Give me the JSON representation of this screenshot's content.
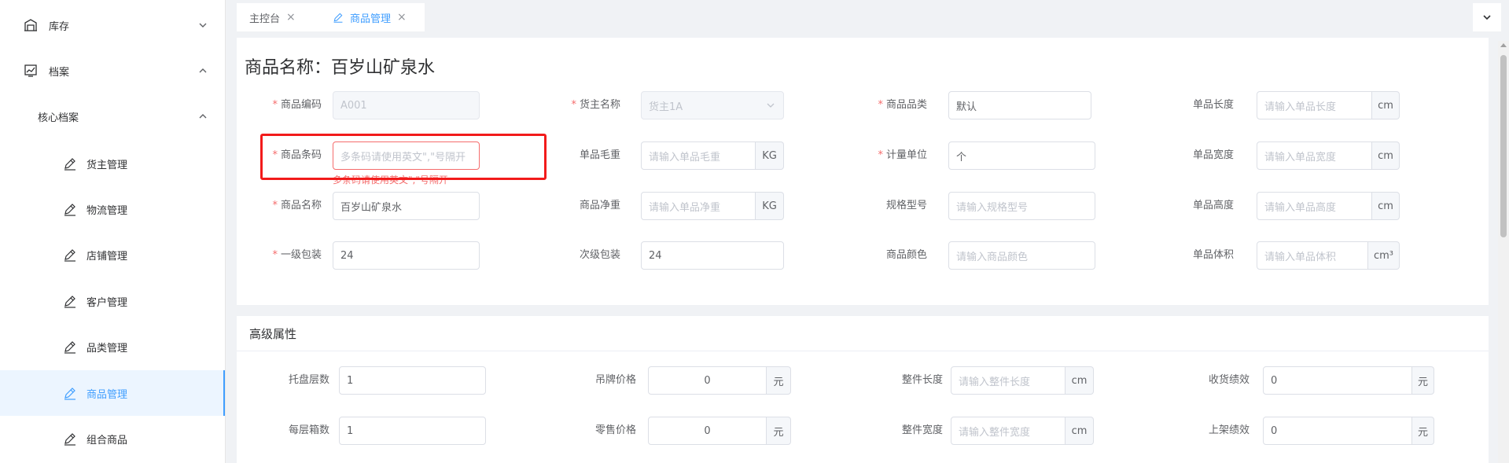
{
  "sidebar": {
    "items": [
      {
        "label": "库存",
        "icon": "warehouse-icon",
        "arrow": "chevron-down-icon"
      },
      {
        "label": "档案",
        "icon": "archive-icon",
        "arrow": "chevron-up-icon"
      },
      {
        "label": "核心档案",
        "arrow": "chevron-up-icon"
      },
      {
        "label": "货主管理",
        "icon": "edit-icon"
      },
      {
        "label": "物流管理",
        "icon": "edit-icon"
      },
      {
        "label": "店铺管理",
        "icon": "edit-icon"
      },
      {
        "label": "客户管理",
        "icon": "edit-icon"
      },
      {
        "label": "品类管理",
        "icon": "edit-icon"
      },
      {
        "label": "商品管理",
        "icon": "edit-icon",
        "active": true
      },
      {
        "label": "组合商品",
        "icon": "edit-icon"
      }
    ]
  },
  "tabs": [
    {
      "label": "主控台",
      "close": "×"
    },
    {
      "label": "商品管理",
      "close": "×",
      "active": true
    }
  ],
  "page_title": "商品名称：百岁山矿泉水",
  "basic": {
    "code": {
      "label": "商品编码",
      "value": "A001"
    },
    "owner": {
      "label": "货主名称",
      "value": "货主1A"
    },
    "category": {
      "label": "商品品类",
      "value": "默认"
    },
    "length": {
      "label": "单品长度",
      "placeholder": "请输入单品长度",
      "unit": "cm"
    },
    "barcode": {
      "label": "商品条码",
      "placeholder": "多条码请使用英文\",\"号隔开",
      "error": "多条码请使用英文\",\"号隔开"
    },
    "gross_weight": {
      "label": "单品毛重",
      "placeholder": "请输入单品毛重",
      "unit": "KG"
    },
    "unit": {
      "label": "计量单位",
      "value": "个"
    },
    "width": {
      "label": "单品宽度",
      "placeholder": "请输入单品宽度",
      "unit": "cm"
    },
    "name": {
      "label": "商品名称",
      "value": "百岁山矿泉水"
    },
    "net_weight": {
      "label": "商品净重",
      "placeholder": "请输入单品净重",
      "unit": "KG"
    },
    "spec": {
      "label": "规格型号",
      "placeholder": "请输入规格型号"
    },
    "height": {
      "label": "单品高度",
      "placeholder": "请输入单品高度",
      "unit": "cm"
    },
    "pack1": {
      "label": "一级包装",
      "value": "24"
    },
    "pack2": {
      "label": "次级包装",
      "value": "24"
    },
    "color": {
      "label": "商品颜色",
      "placeholder": "请输入商品颜色"
    },
    "volume": {
      "label": "单品体积",
      "placeholder": "请输入单品体积",
      "unit": "cm³"
    }
  },
  "advanced": {
    "title": "高级属性",
    "pallet_layers": {
      "label": "托盘层数",
      "value": "1"
    },
    "tag_price": {
      "label": "吊牌价格",
      "value": "0",
      "unit": "元"
    },
    "case_length": {
      "label": "整件长度",
      "placeholder": "请输入整件长度",
      "unit": "cm"
    },
    "receive_perf": {
      "label": "收货绩效",
      "value": "0",
      "unit": "元"
    },
    "boxes_per_layer": {
      "label": "每层箱数",
      "value": "1"
    },
    "retail_price": {
      "label": "零售价格",
      "value": "0",
      "unit": "元"
    },
    "case_width": {
      "label": "整件宽度",
      "placeholder": "请输入整件宽度",
      "unit": "cm"
    },
    "shelve_perf": {
      "label": "上架绩效",
      "value": "0",
      "unit": "元"
    }
  },
  "colors": {
    "accent": "#409eff",
    "error": "#f56c6c",
    "highlight": "#f21b1b"
  }
}
